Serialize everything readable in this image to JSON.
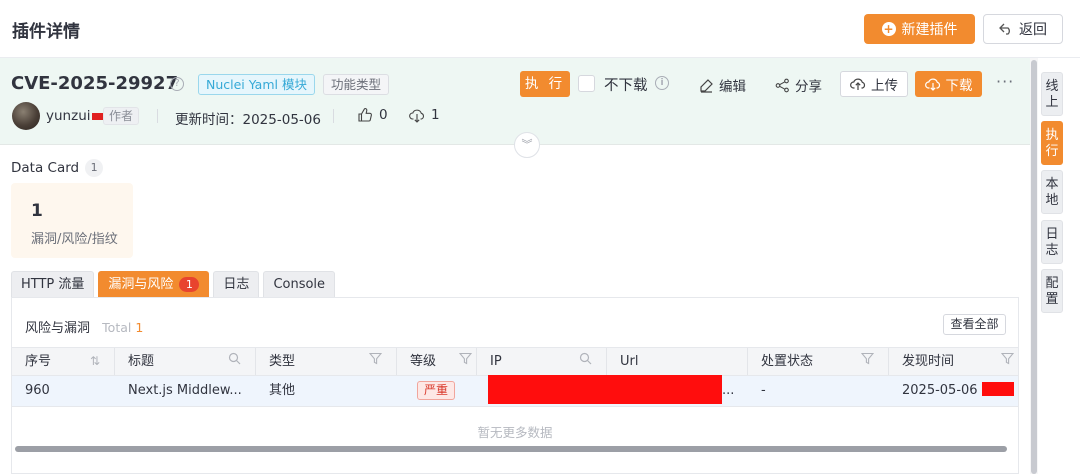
{
  "page": {
    "title": "插件详情"
  },
  "top_actions": {
    "new_plugin": "新建插件",
    "back": "返回"
  },
  "plugin": {
    "name": "CVE-2025-29927",
    "type_tag": "Nuclei Yaml 模块",
    "category_tag": "功能类型",
    "execute": "执 行",
    "no_download": "不下载",
    "edit": "编辑",
    "share": "分享",
    "upload": "上传",
    "download": "下载",
    "more": "···",
    "author": "yunzui",
    "author_tag": "作者",
    "update_time": "更新时间：2025-05-06",
    "likes": "0",
    "downloads": "1"
  },
  "data_card": {
    "label": "Data Card",
    "count": "1",
    "cards": [
      {
        "value": "1",
        "label": "漏洞/风险/指纹"
      }
    ]
  },
  "tabs": [
    {
      "label": "HTTP 流量"
    },
    {
      "label": "漏洞与风险",
      "badge": "1",
      "active": true
    },
    {
      "label": "日志"
    },
    {
      "label": "Console"
    }
  ],
  "risk_table": {
    "title": "风险与漏洞",
    "total_label": "Total",
    "total": "1",
    "view_all": "查看全部",
    "columns": [
      "序号",
      "标题",
      "类型",
      "等级",
      "IP",
      "Url",
      "处置状态",
      "发现时间"
    ],
    "rows": [
      {
        "id": "960",
        "title": "Next.js Middlew...",
        "type": "其他",
        "level": "严重",
        "ip": "",
        "url": "...",
        "status": "-",
        "found": "2025-05-06"
      }
    ],
    "empty_hint": "暂无更多数据"
  },
  "side_tabs": [
    {
      "label": "线上"
    },
    {
      "label": "执行",
      "active": true
    },
    {
      "label": "本地"
    },
    {
      "label": "日志"
    },
    {
      "label": "配置"
    }
  ],
  "colors": {
    "accent": "#f28b2f",
    "header_bg": "#eef7f3",
    "danger": "#e8442e"
  }
}
